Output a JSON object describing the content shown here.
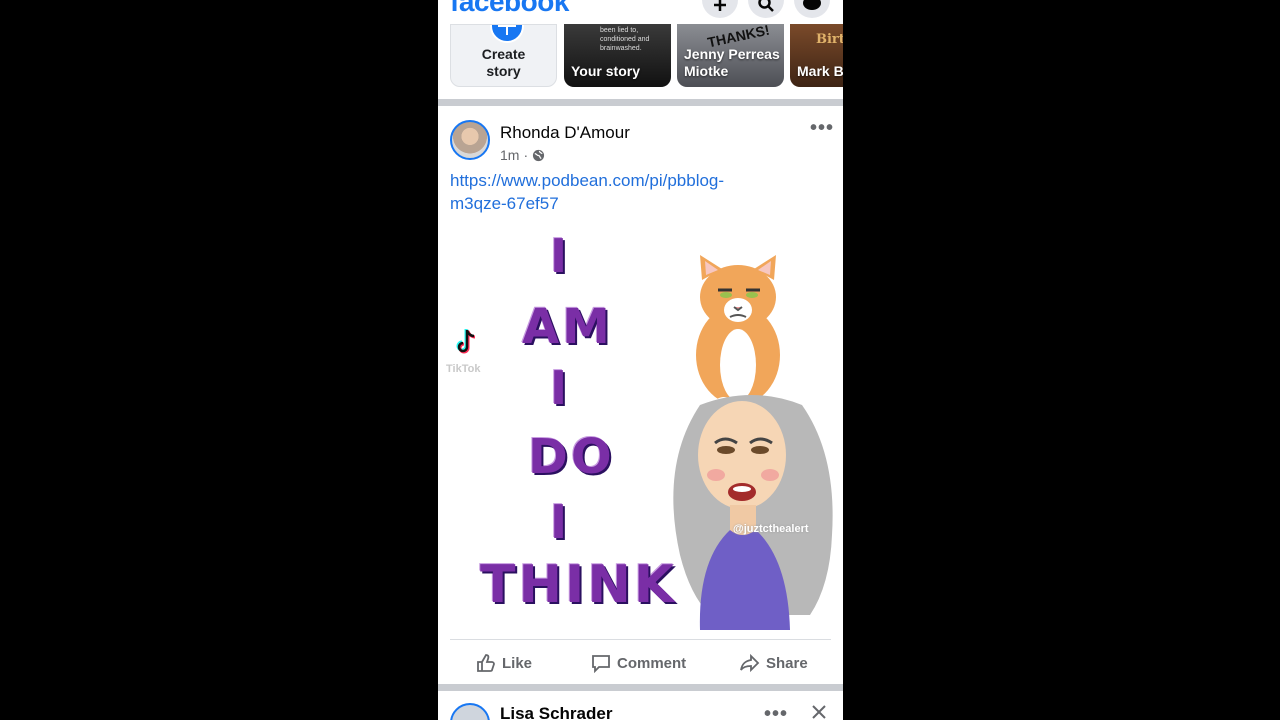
{
  "header": {
    "logo": "facebook",
    "brand_color": "#1877f2",
    "buttons": [
      "add-icon",
      "search-icon",
      "messenger-icon"
    ]
  },
  "stories": {
    "create_label": "Create\nstory",
    "items": [
      {
        "label": "Your story",
        "snippet": "been lied to,\nconditioned and\nbrainwashed."
      },
      {
        "label": "Jenny Perreas Miotke",
        "snippet": "THANKS!"
      },
      {
        "label": "Mark B",
        "snippet": "Birth"
      }
    ]
  },
  "post": {
    "author": "Rhonda D'Amour",
    "time": "1m",
    "privacy_icon": "globe-icon",
    "link": "https://www.podbean.com/pi/pbblog-m3qze-67ef57",
    "media": {
      "words": [
        "I",
        "AM",
        "I",
        "DO",
        "I",
        "THINK"
      ],
      "watermark": "TikTok",
      "watermark_handle": "@juztcthealert",
      "word_color": "#7a2ea6"
    },
    "actions": {
      "like": "Like",
      "comment": "Comment",
      "share": "Share"
    }
  },
  "next_post": {
    "author": "Lisa Schrader"
  }
}
